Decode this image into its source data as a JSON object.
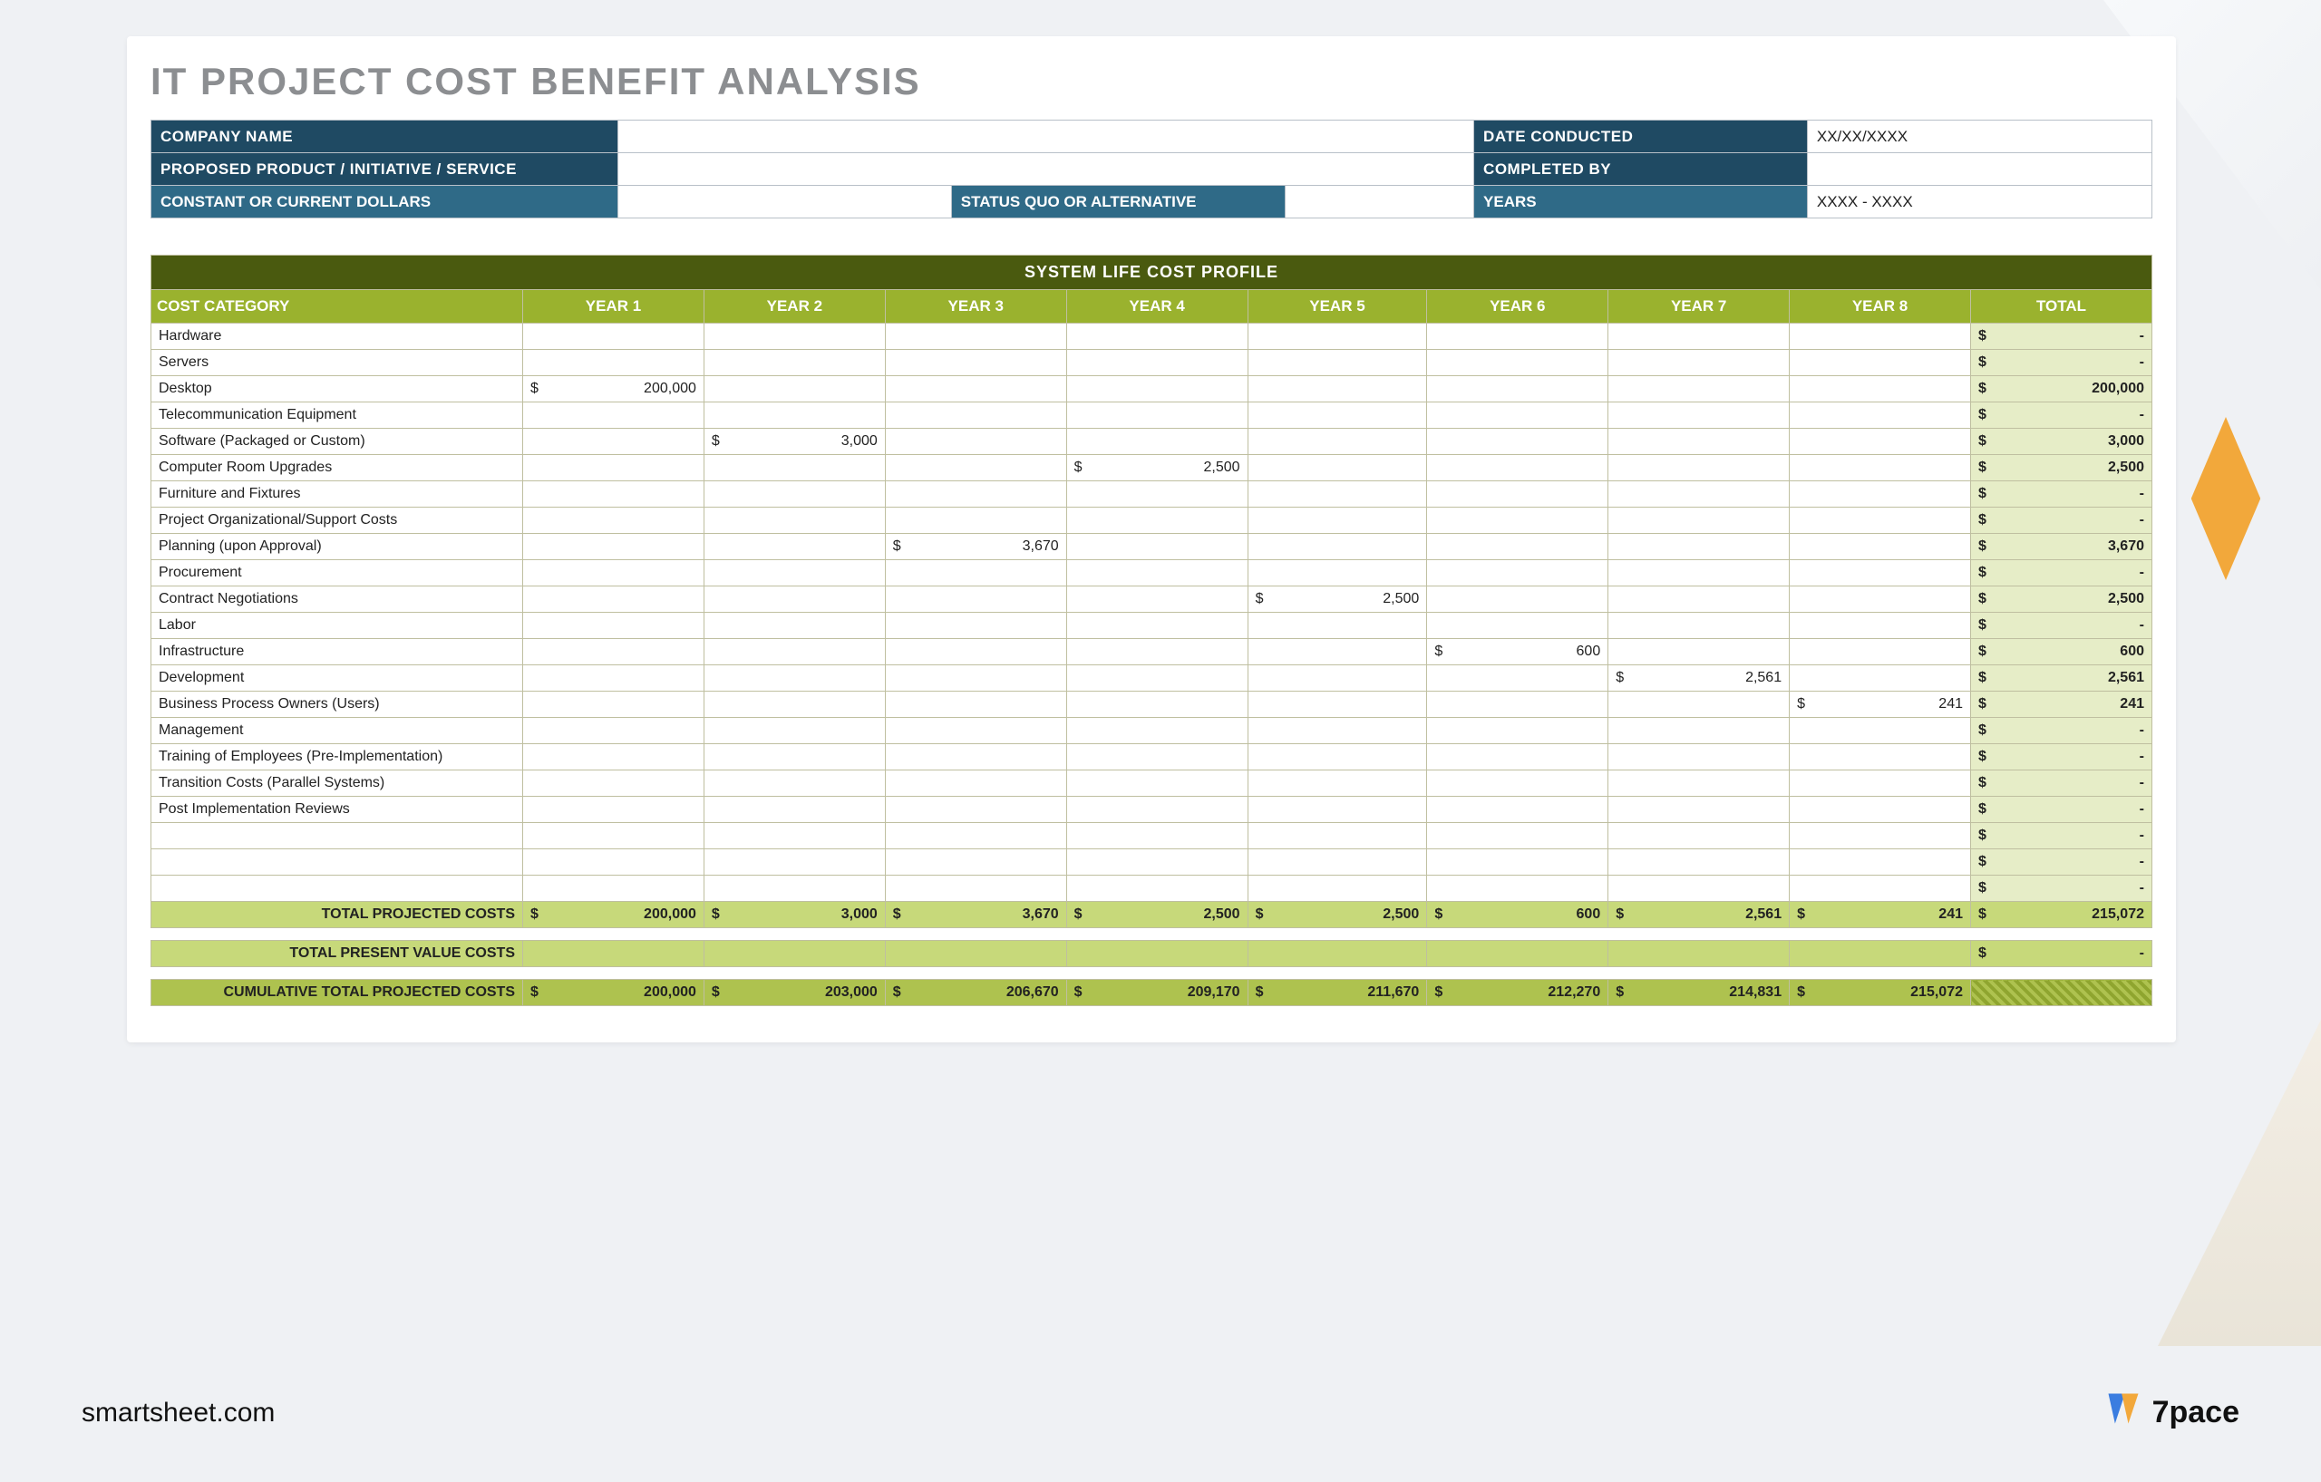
{
  "title": "IT PROJECT COST BENEFIT ANALYSIS",
  "header": {
    "labels": {
      "company": "COMPANY NAME",
      "date": "DATE CONDUCTED",
      "product": "PROPOSED PRODUCT / INITIATIVE / SERVICE",
      "completed_by": "COMPLETED BY",
      "dollars": "CONSTANT OR CURRENT DOLLARS",
      "status_quo": "STATUS QUO OR ALTERNATIVE",
      "years": "YEARS"
    },
    "values": {
      "company": "",
      "date": "XX/XX/XXXX",
      "product": "",
      "completed_by": "",
      "dollars": "",
      "status_quo": "",
      "years": "XXXX - XXXX"
    }
  },
  "cost_table": {
    "banner": "SYSTEM LIFE COST PROFILE",
    "cat_header": "COST CATEGORY",
    "year_headers": [
      "YEAR 1",
      "YEAR 2",
      "YEAR 3",
      "YEAR 4",
      "YEAR 5",
      "YEAR 6",
      "YEAR 7",
      "YEAR 8"
    ],
    "total_header": "TOTAL",
    "rows": [
      {
        "name": "Hardware",
        "y": [
          "",
          "",
          "",
          "",
          "",
          "",
          "",
          ""
        ],
        "total": "-"
      },
      {
        "name": "Servers",
        "y": [
          "",
          "",
          "",
          "",
          "",
          "",
          "",
          ""
        ],
        "total": "-"
      },
      {
        "name": "Desktop",
        "y": [
          "200,000",
          "",
          "",
          "",
          "",
          "",
          "",
          ""
        ],
        "total": "200,000"
      },
      {
        "name": "Telecommunication Equipment",
        "y": [
          "",
          "",
          "",
          "",
          "",
          "",
          "",
          ""
        ],
        "total": "-"
      },
      {
        "name": "Software (Packaged or Custom)",
        "y": [
          "",
          "3,000",
          "",
          "",
          "",
          "",
          "",
          ""
        ],
        "total": "3,000"
      },
      {
        "name": "Computer Room Upgrades",
        "y": [
          "",
          "",
          "",
          "2,500",
          "",
          "",
          "",
          ""
        ],
        "total": "2,500"
      },
      {
        "name": "Furniture and Fixtures",
        "y": [
          "",
          "",
          "",
          "",
          "",
          "",
          "",
          ""
        ],
        "total": "-"
      },
      {
        "name": "Project Organizational/Support Costs",
        "y": [
          "",
          "",
          "",
          "",
          "",
          "",
          "",
          ""
        ],
        "total": "-"
      },
      {
        "name": "Planning (upon Approval)",
        "y": [
          "",
          "",
          "3,670",
          "",
          "",
          "",
          "",
          ""
        ],
        "total": "3,670"
      },
      {
        "name": "Procurement",
        "y": [
          "",
          "",
          "",
          "",
          "",
          "",
          "",
          ""
        ],
        "total": "-"
      },
      {
        "name": "Contract Negotiations",
        "y": [
          "",
          "",
          "",
          "",
          "2,500",
          "",
          "",
          ""
        ],
        "total": "2,500"
      },
      {
        "name": "Labor",
        "y": [
          "",
          "",
          "",
          "",
          "",
          "",
          "",
          ""
        ],
        "total": "-"
      },
      {
        "name": "Infrastructure",
        "y": [
          "",
          "",
          "",
          "",
          "",
          "600",
          "",
          ""
        ],
        "total": "600"
      },
      {
        "name": "Development",
        "y": [
          "",
          "",
          "",
          "",
          "",
          "",
          "2,561",
          ""
        ],
        "total": "2,561"
      },
      {
        "name": "Business Process Owners (Users)",
        "y": [
          "",
          "",
          "",
          "",
          "",
          "",
          "",
          "241"
        ],
        "total": "241"
      },
      {
        "name": "Management",
        "y": [
          "",
          "",
          "",
          "",
          "",
          "",
          "",
          ""
        ],
        "total": "-"
      },
      {
        "name": "Training of Employees (Pre-Implementation)",
        "y": [
          "",
          "",
          "",
          "",
          "",
          "",
          "",
          ""
        ],
        "total": "-"
      },
      {
        "name": "Transition Costs (Parallel Systems)",
        "y": [
          "",
          "",
          "",
          "",
          "",
          "",
          "",
          ""
        ],
        "total": "-"
      },
      {
        "name": "Post Implementation Reviews",
        "y": [
          "",
          "",
          "",
          "",
          "",
          "",
          "",
          ""
        ],
        "total": "-"
      },
      {
        "name": "",
        "y": [
          "",
          "",
          "",
          "",
          "",
          "",
          "",
          ""
        ],
        "total": "-"
      },
      {
        "name": "",
        "y": [
          "",
          "",
          "",
          "",
          "",
          "",
          "",
          ""
        ],
        "total": "-"
      },
      {
        "name": "",
        "y": [
          "",
          "",
          "",
          "",
          "",
          "",
          "",
          ""
        ],
        "total": "-"
      }
    ],
    "total_projected": {
      "label": "TOTAL PROJECTED COSTS",
      "y": [
        "200,000",
        "3,000",
        "3,670",
        "2,500",
        "2,500",
        "600",
        "2,561",
        "241"
      ],
      "total": "215,072"
    },
    "present_value": {
      "label": "TOTAL PRESENT VALUE COSTS",
      "y": [
        "",
        "",
        "",
        "",
        "",
        "",
        "",
        ""
      ],
      "total": "-"
    },
    "cumulative": {
      "label": "CUMULATIVE TOTAL PROJECTED COSTS",
      "y": [
        "200,000",
        "203,000",
        "206,670",
        "209,170",
        "211,670",
        "212,270",
        "214,831",
        "215,072"
      ],
      "total": ""
    }
  },
  "footer": {
    "source": "smartsheet.com",
    "brand": "7pace"
  }
}
